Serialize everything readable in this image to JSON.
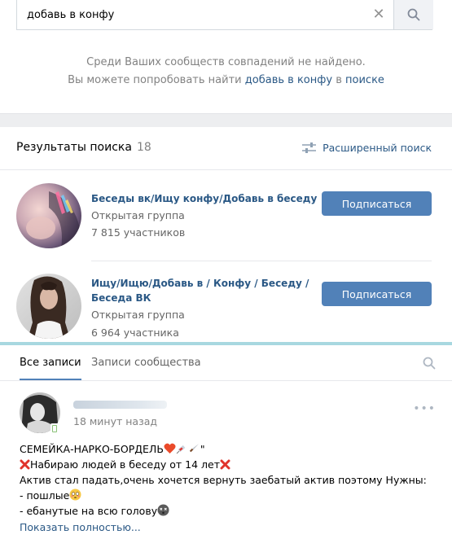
{
  "search": {
    "value": "добавь в конфу",
    "clear_icon": "close-icon",
    "button_icon": "search-icon"
  },
  "no_results": {
    "line1": "Среди Ваших сообществ совпадений не найдено.",
    "line2_prefix": "Вы можете попробовать найти",
    "line2_link": "добавь в конфу",
    "line2_middle": "в",
    "line2_link2": "поиске"
  },
  "results": {
    "title": "Результаты поиска",
    "count": "18",
    "advanced_label": "Расширенный поиск",
    "advanced_icon": "sliders-icon",
    "groups": [
      {
        "name": "Беседы вк/Ищу конфу/Добавь в беседу",
        "type": "Открытая группа",
        "members": "7 815 участников",
        "button": "Подписаться"
      },
      {
        "name": "Ищу/Ищю/Добавь в / Конфу / Беседу / Беседа ВК",
        "type": "Открытая группа",
        "members": "6 964 участника",
        "button": "Подписаться"
      }
    ]
  },
  "wall": {
    "tabs": [
      "Все записи",
      "Записи сообщества"
    ],
    "active_tab": "Все записи",
    "post": {
      "time": "18 минут назад",
      "lines": [
        "СЕМЕЙКА-НАРКО-БОРДЕЛЬ",
        "Набираю людей в беседу от 14 лет",
        "Актив стал падать,очень хочется вернуть заебатый актив поэтому Нужны:",
        "- пошлые",
        "- ебанутые на всю голову"
      ],
      "quote_mark": "\"",
      "show_more": "Показать полностью..."
    }
  },
  "colors": {
    "link": "#2a5885",
    "button": "#5181b8",
    "accent_line": "#a8d8e0",
    "background": "#edeef0"
  }
}
